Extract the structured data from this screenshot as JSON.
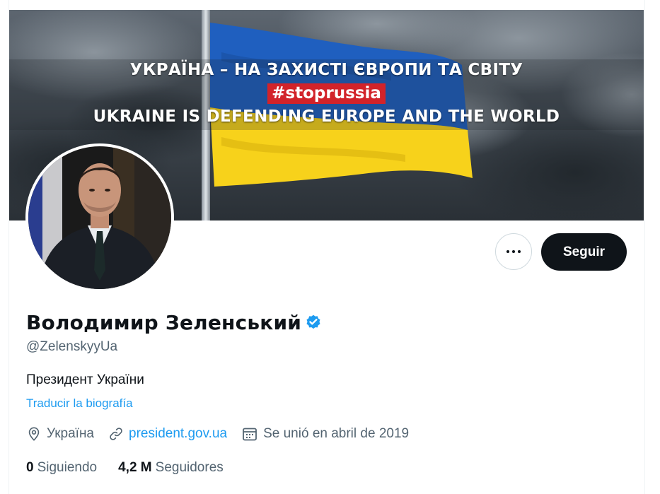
{
  "banner": {
    "line1": "УКРАЇНА – НА ЗАХИСТІ ЄВРОПИ ТА СВІТУ",
    "hashtag": "#stoprussia",
    "line2": "UKRAINE IS DEFENDING EUROPE AND THE WORLD",
    "flag_colors": {
      "blue": "#1f5fbf",
      "yellow": "#f7d21b"
    }
  },
  "actions": {
    "more_icon": "ellipsis-icon",
    "follow_label": "Seguir"
  },
  "profile": {
    "display_name": "Володимир Зеленський",
    "verified_icon": "verified-badge-icon",
    "handle": "@ZelenskyyUa",
    "bio": "Президент України",
    "translate_label": "Traducir la biografía",
    "location": "Україна",
    "location_icon": "location-pin-icon",
    "website": "president.gov.ua",
    "website_icon": "link-icon",
    "joined": "Se unió en abril de 2019",
    "joined_icon": "calendar-icon"
  },
  "stats": {
    "following_count": "0",
    "following_label": "Siguiendo",
    "followers_count": "4,2 M",
    "followers_label": "Seguidores"
  },
  "colors": {
    "accent": "#1d9bf0",
    "text_primary": "#0f1419",
    "text_secondary": "#536471",
    "follow_button_bg": "#0f1419",
    "hashtag_bg": "#d2232a"
  }
}
